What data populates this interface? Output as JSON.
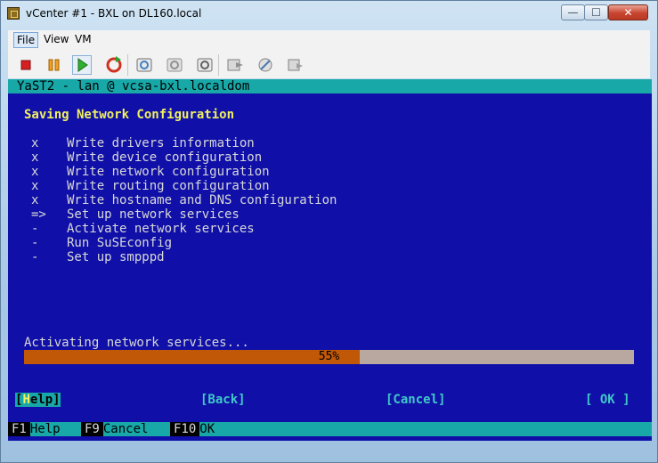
{
  "window": {
    "title": "vCenter #1 - BXL on DL160.local",
    "min_glyph": "—",
    "max_glyph": "☐",
    "close_glyph": "✕"
  },
  "menu": [
    "File",
    "View",
    "VM"
  ],
  "toolbar_icons": [
    "stop-icon",
    "pause-icon",
    "play-icon",
    "reset-icon",
    "snapshot-icon",
    "revert-snapshot-icon",
    "snapshot-manager-icon",
    "settings-icon",
    "tools-icon",
    "connect-icon"
  ],
  "console": {
    "titlebar": "YaST2 - lan @ vcsa-bxl.localdom",
    "heading": "Saving Network Configuration",
    "steps": [
      {
        "mark": "x",
        "label": "Write drivers information"
      },
      {
        "mark": "x",
        "label": "Write device configuration"
      },
      {
        "mark": "x",
        "label": "Write network configuration"
      },
      {
        "mark": "x",
        "label": "Write routing configuration"
      },
      {
        "mark": "x",
        "label": "Write hostname and DNS configuration"
      },
      {
        "mark": "=>",
        "label": "Set up network services"
      },
      {
        "mark": "-",
        "label": "Activate network services"
      },
      {
        "mark": "-",
        "label": "Run SuSEconfig"
      },
      {
        "mark": "-",
        "label": "Set up smpppd"
      }
    ],
    "status": "Activating network services...",
    "progress": {
      "percent": 55,
      "label": "55%"
    },
    "buttons": {
      "help_open": "[",
      "help_hot": "H",
      "help_rest": "elp]",
      "back": "[Back]",
      "cancel": "[Cancel]",
      "ok": "[ OK ]"
    },
    "fkeys": [
      {
        "key": "F1",
        "label": "Help"
      },
      {
        "key": "F9",
        "label": "Cancel"
      },
      {
        "key": "F10",
        "label": "OK"
      }
    ]
  },
  "colors": {
    "console_bg": "#1010a8",
    "cyan": "#18a8a8",
    "heading": "#f0f060",
    "progress_fill": "#c05808"
  }
}
